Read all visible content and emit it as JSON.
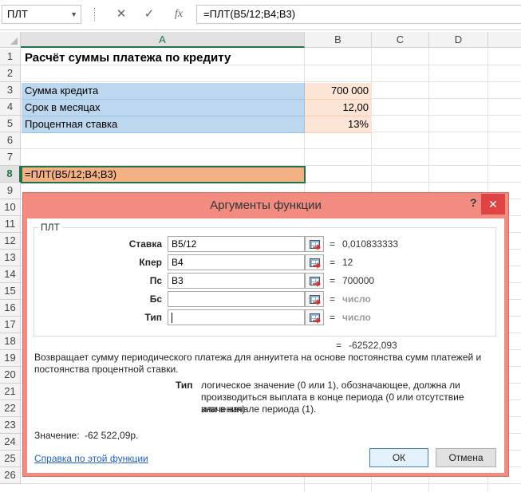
{
  "formula_bar": {
    "name_box": "ПЛТ",
    "cancel_icon": "✕",
    "enter_icon": "✓",
    "fx_label": "fx",
    "formula": "=ПЛТ(B5/12;B4;B3)"
  },
  "columns": [
    "A",
    "B",
    "C",
    "D"
  ],
  "rows": [
    "1",
    "2",
    "3",
    "4",
    "5",
    "6",
    "7",
    "8",
    "9",
    "10",
    "11",
    "12",
    "13",
    "14",
    "15",
    "16",
    "17",
    "18",
    "19",
    "20",
    "21",
    "22",
    "23",
    "24",
    "25",
    "26"
  ],
  "cells": {
    "a1": "Расчёт суммы платежа по кредиту",
    "a3": "Сумма кредита",
    "b3": "700 000",
    "a4": "Срок в месяцах",
    "b4": "12,00",
    "a5": "Процентная ставка",
    "b5": "13%",
    "a8": "=ПЛТ(B5/12;B4;B3)"
  },
  "dialog": {
    "title": "Аргументы функции",
    "help": "?",
    "close": "✕",
    "function_name": "ПЛТ",
    "args": [
      {
        "label": "Ставка",
        "value": "B5/12",
        "result": "0,010833333"
      },
      {
        "label": "Кпер",
        "value": "B4",
        "result": "12"
      },
      {
        "label": "Пс",
        "value": "B3",
        "result": "700000"
      },
      {
        "label": "Бс",
        "value": "",
        "result": "число"
      },
      {
        "label": "Тип",
        "value": "",
        "result": "число"
      }
    ],
    "eq_sign": "=",
    "total_result": "-62522,093",
    "description_line1": "Возвращает сумму периодического платежа для аннуитета на основе постоянства сумм платежей и",
    "description_line2": "постоянства процентной ставки.",
    "param_name": "Тип",
    "param_desc_line1": "логическое значение (0 или 1), обозначающее, должна ли",
    "param_desc_line2": "производиться выплата в конце периода (0 или отсутствие значения)",
    "param_desc_line3": "или в начале периода (1).",
    "value_label": "Значение:",
    "value": "-62 522,09р.",
    "help_link": "Справка по этой функции",
    "ok": "ОК",
    "cancel": "Отмена"
  },
  "colors": {
    "input_fill": "#bdd7ee",
    "value_fill": "#fce4d6",
    "active_fill": "#f4b183",
    "dialog_frame": "#f28b80",
    "select_accent": "#217346"
  }
}
